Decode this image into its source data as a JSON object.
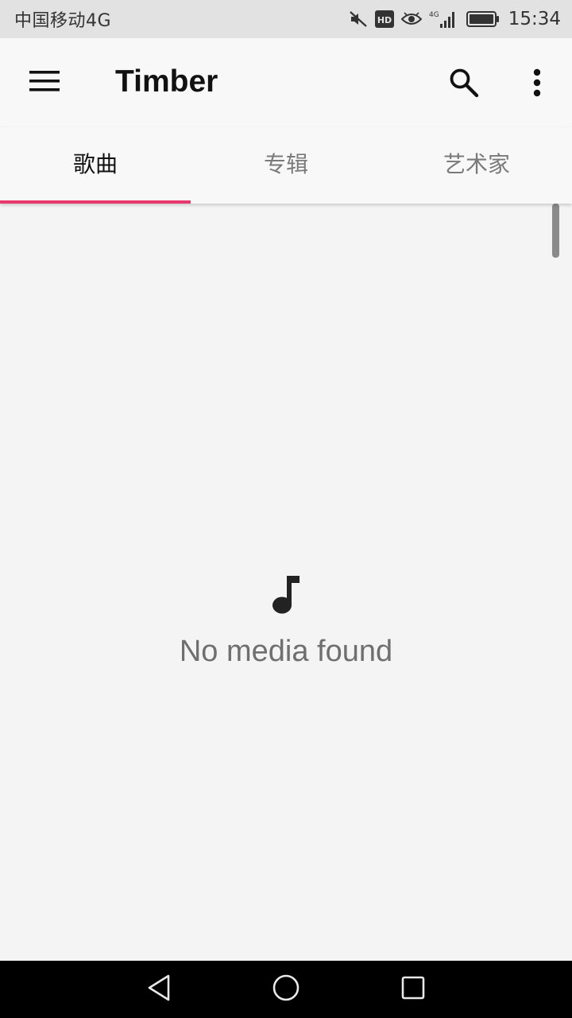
{
  "status_bar": {
    "carrier": "中国移动4G",
    "network_label": "4G",
    "hd_label": "HD",
    "time": "15:34",
    "icons": [
      "mute-icon",
      "hd-icon",
      "eye-icon",
      "signal-icon",
      "battery-icon"
    ]
  },
  "app_bar": {
    "title": "Timber",
    "icons": [
      "menu-icon",
      "search-icon",
      "more-vert-icon"
    ]
  },
  "tabs": [
    {
      "label": "歌曲",
      "active": true
    },
    {
      "label": "专辑",
      "active": false
    },
    {
      "label": "艺术家",
      "active": false
    }
  ],
  "empty_state": {
    "icon": "music-note-icon",
    "message": "No media found"
  },
  "nav_bar": {
    "icons": [
      "back-icon",
      "home-icon",
      "recents-icon"
    ]
  },
  "colors": {
    "accent": "#e8386d",
    "status_bar_bg": "#e2e2e2",
    "app_bar_bg": "#f8f8f8",
    "content_bg": "#f4f4f4",
    "nav_bar_bg": "#000000"
  }
}
